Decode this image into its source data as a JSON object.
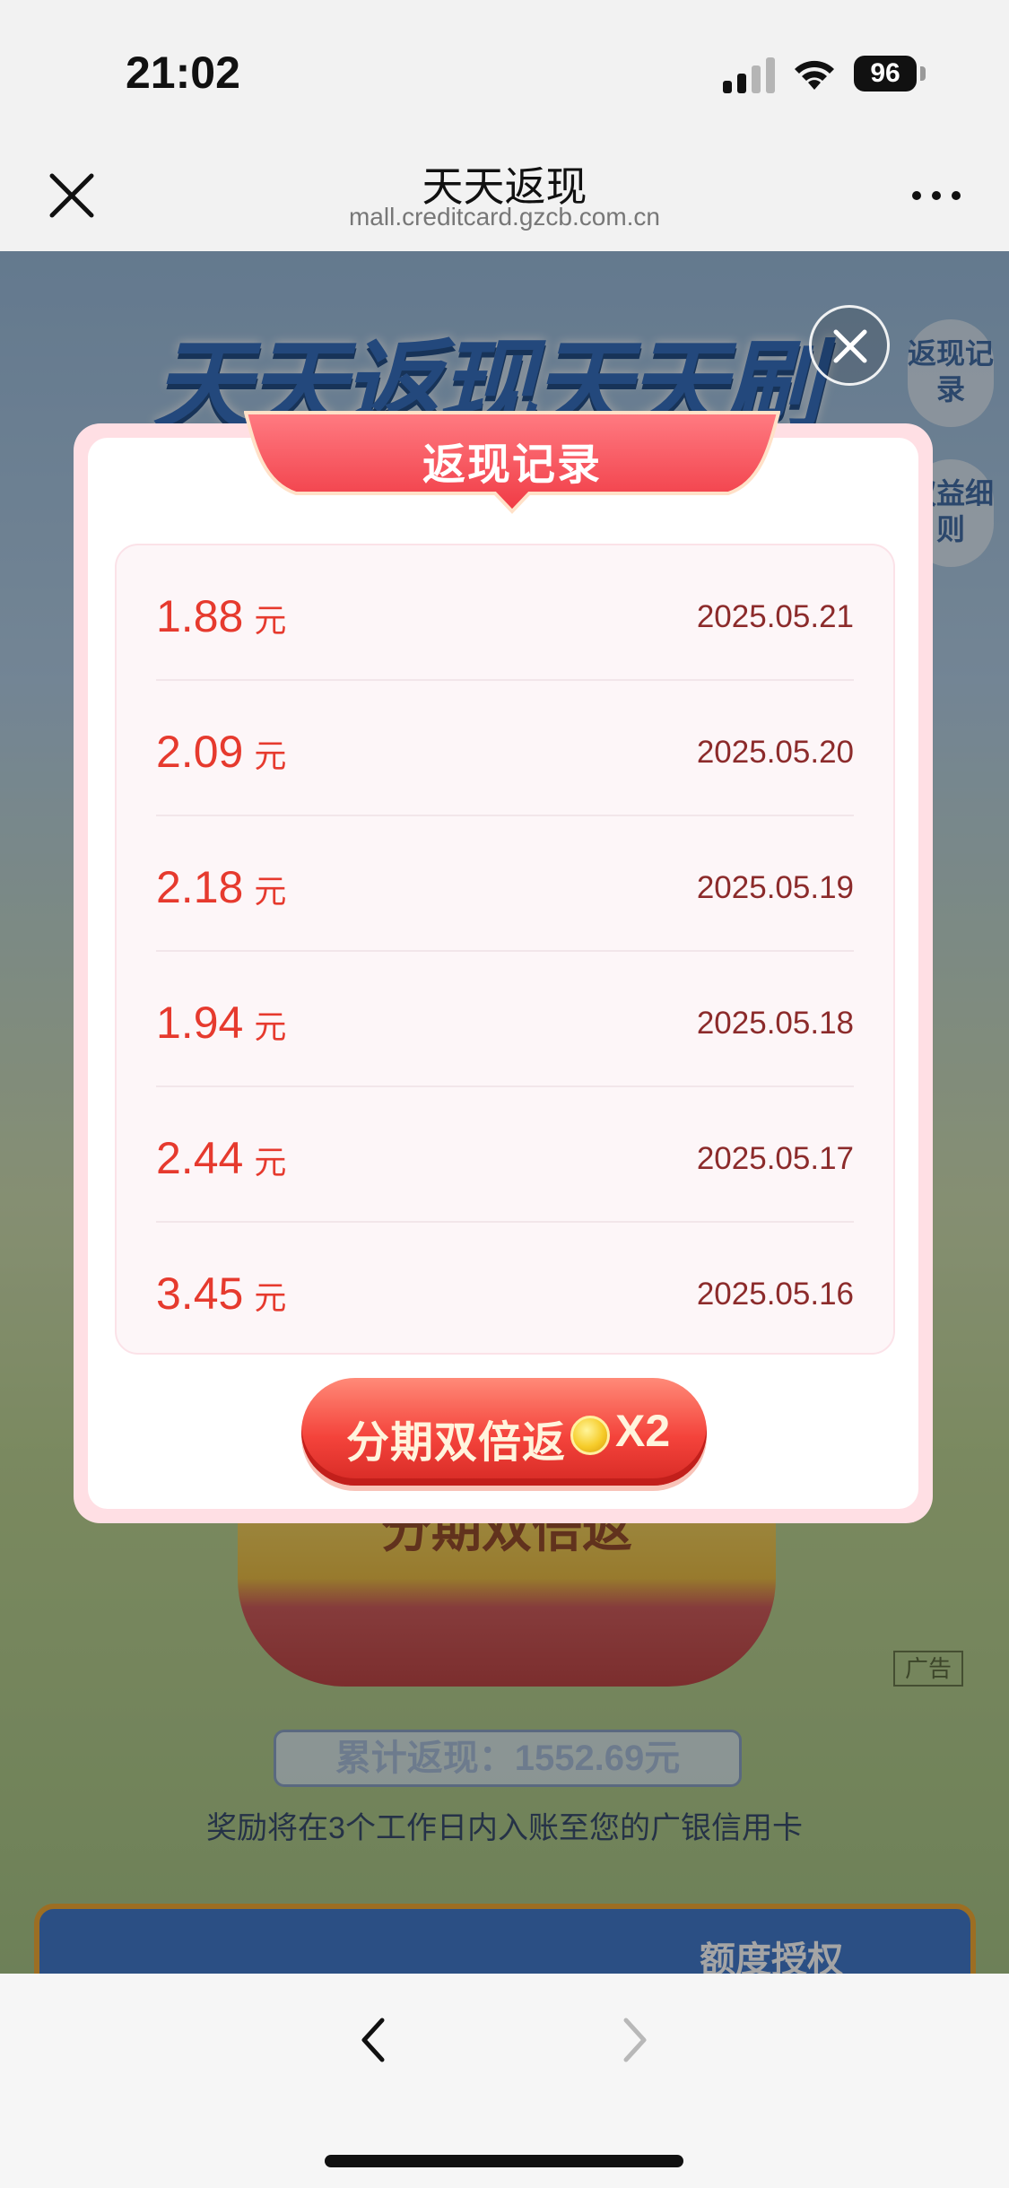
{
  "status_bar": {
    "time": "21:02",
    "battery": "96"
  },
  "nav": {
    "title": "天天返现",
    "url": "mall.creditcard.gzcb.com.cn"
  },
  "page": {
    "hero_title": "天天返现天天刷",
    "side_buttons": [
      "返现记录",
      "权益细则"
    ],
    "pedestal_text": "分期双倍返",
    "ad_label": "广告",
    "total_cashback": "累计返现：1552.69元",
    "note": "奖励将在3个工作日内入账至您的广银信用卡",
    "banner_text": "额度授权"
  },
  "modal": {
    "title": "返现记录",
    "records": [
      {
        "amount": "1.88",
        "unit": "元",
        "date": "2025.05.21"
      },
      {
        "amount": "2.09",
        "unit": "元",
        "date": "2025.05.20"
      },
      {
        "amount": "2.18",
        "unit": "元",
        "date": "2025.05.19"
      },
      {
        "amount": "1.94",
        "unit": "元",
        "date": "2025.05.18"
      },
      {
        "amount": "2.44",
        "unit": "元",
        "date": "2025.05.17"
      },
      {
        "amount": "3.45",
        "unit": "元",
        "date": "2025.05.16"
      }
    ],
    "cta_label": "分期双倍返",
    "cta_multiplier": "X2"
  },
  "colors": {
    "amount_red": "#e63a2e",
    "date_brown": "#8c2b2b",
    "header_red": "#f04a4e",
    "modal_border_pink": "#ffdfe4"
  }
}
